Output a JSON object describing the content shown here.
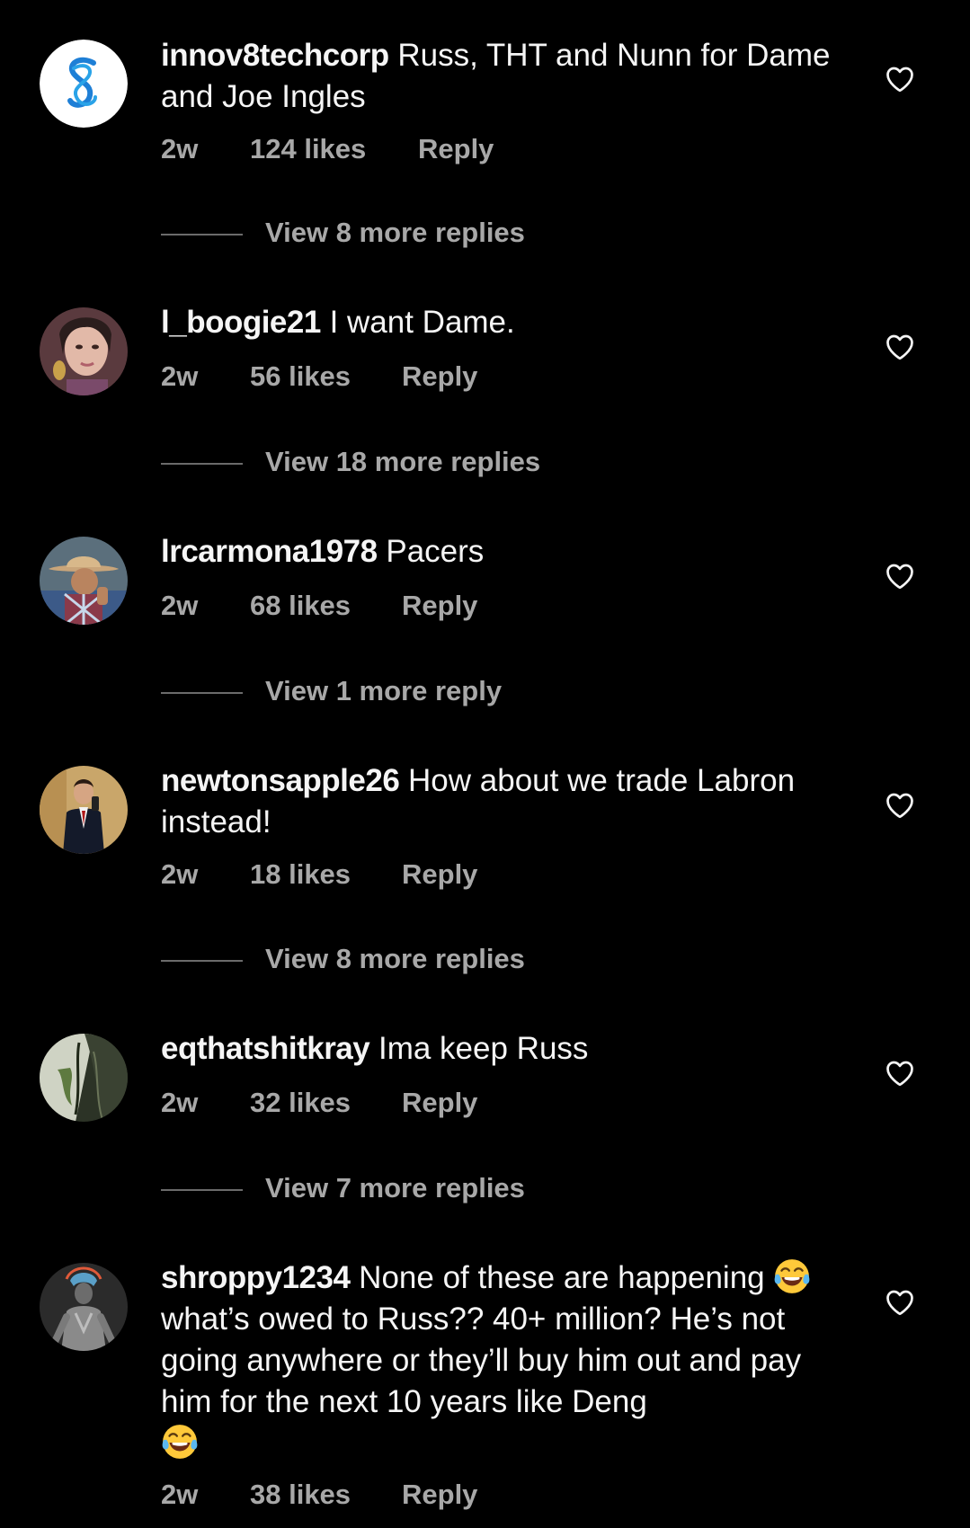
{
  "comments": [
    {
      "username": "innov8techcorp",
      "text": "Russ, THT and Nunn for Dame and Joe Ingles",
      "age": "2w",
      "likes": "124 likes",
      "reply": "Reply",
      "view_replies": "View 8 more replies",
      "avatar": "s-logo-avatar"
    },
    {
      "username": "l_boogie21",
      "text": "I want Dame.",
      "age": "2w",
      "likes": "56 likes",
      "reply": "Reply",
      "view_replies": "View 18 more replies",
      "avatar": "woman-portrait-avatar"
    },
    {
      "username": "lrcarmona1978",
      "text": "Pacers",
      "age": "2w",
      "likes": "68 likes",
      "reply": "Reply",
      "view_replies": "View 1 more reply",
      "avatar": "cowboy-hat-avatar"
    },
    {
      "username": "newtonsapple26",
      "text": "How about we trade Labron instead!",
      "age": "2w",
      "likes": "18 likes",
      "reply": "Reply",
      "view_replies": "View 8 more replies",
      "avatar": "man-in-suit-avatar"
    },
    {
      "username": "eqthatshitkray",
      "text": "Ima keep Russ",
      "age": "2w",
      "likes": "32 likes",
      "reply": "Reply",
      "view_replies": "View 7 more replies",
      "avatar": "outdoor-photo-avatar"
    },
    {
      "username": "shroppy1234",
      "text_parts": [
        "None of these are happening ",
        " what’s owed to Russ?? 40+ million? He’s not going anywhere or they’ll buy him out and pay him for the next 10 years like Deng ",
        ""
      ],
      "emoji": "face-with-tears-of-joy",
      "age": "2w",
      "likes": "38 likes",
      "reply": "Reply",
      "avatar": "superhero-avatar"
    }
  ],
  "icons": {
    "like": "heart-outline-icon"
  },
  "colors": {
    "background": "#000000",
    "primary_text": "#f5f5f5",
    "secondary_text": "#a8a8a8",
    "divider": "#6b6b6b"
  }
}
